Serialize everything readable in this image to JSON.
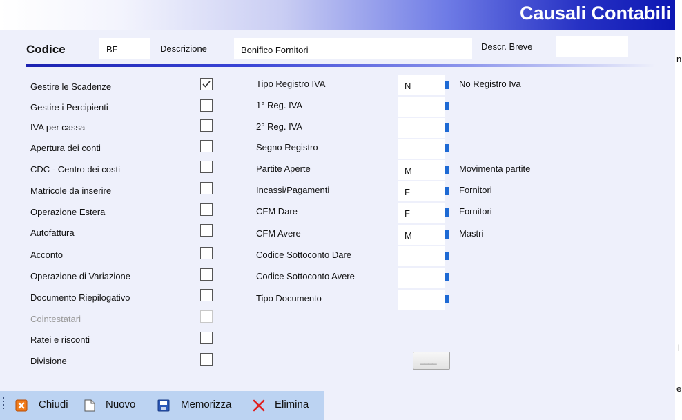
{
  "window": {
    "title": "Causali Contabili"
  },
  "header": {
    "codice_label": "Codice",
    "codice_value": "BF",
    "descrizione_label": "Descrizione",
    "descrizione_value": "Bonifico Fornitori",
    "descr_breve_label": "Descr. Breve",
    "descr_breve_value": ""
  },
  "options": [
    {
      "label": "Gestire le Scadenze",
      "checked": true,
      "enabled": true
    },
    {
      "label": "Gestire i Percipienti",
      "checked": false,
      "enabled": true
    },
    {
      "label": "IVA per cassa",
      "checked": false,
      "enabled": true
    },
    {
      "label": "Apertura dei conti",
      "checked": false,
      "enabled": true
    },
    {
      "label": "CDC - Centro dei costi",
      "checked": false,
      "enabled": true
    },
    {
      "label": "Matricole da inserire",
      "checked": false,
      "enabled": true
    },
    {
      "label": "Operazione Estera",
      "checked": false,
      "enabled": true
    },
    {
      "label": "Autofattura",
      "checked": false,
      "enabled": true
    },
    {
      "label": "Acconto",
      "checked": false,
      "enabled": true
    },
    {
      "label": "Operazione di Variazione",
      "checked": false,
      "enabled": true
    },
    {
      "label": "Documento Riepilogativo",
      "checked": false,
      "enabled": true
    },
    {
      "label": "Cointestatari",
      "checked": false,
      "enabled": false
    },
    {
      "label": "Ratei e risconti",
      "checked": false,
      "enabled": true
    },
    {
      "label": "Divisione",
      "checked": false,
      "enabled": true
    }
  ],
  "fields": [
    {
      "label": "Tipo Registro IVA",
      "value": "N",
      "description": "No Registro Iva"
    },
    {
      "label": "1° Reg. IVA",
      "value": "",
      "description": ""
    },
    {
      "label": "2° Reg. IVA",
      "value": "",
      "description": ""
    },
    {
      "label": "Segno Registro",
      "value": "",
      "description": ""
    },
    {
      "label": "Partite Aperte",
      "value": "M",
      "description": "Movimenta partite"
    },
    {
      "label": "Incassi/Pagamenti",
      "value": "F",
      "description": "Fornitori"
    },
    {
      "label": "CFM Dare",
      "value": "F",
      "description": "Fornitori"
    },
    {
      "label": "CFM Avere",
      "value": "M",
      "description": "Mastri"
    },
    {
      "label": "Codice Sottoconto Dare",
      "value": "",
      "description": ""
    },
    {
      "label": "Codice Sottoconto  Avere",
      "value": "",
      "description": ""
    },
    {
      "label": "Tipo Documento",
      "value": "",
      "description": ""
    }
  ],
  "ellipsis_button": {
    "label": "____"
  },
  "toolbar": {
    "close_label": "Chiudi",
    "new_label": "Nuovo",
    "save_label": "Memorizza",
    "delete_label": "Elimina"
  },
  "background_fragments": {
    "a": "n",
    "b": "l",
    "c": "e"
  },
  "icons": {
    "close": "close-icon",
    "new": "new-document-icon",
    "save": "save-disk-icon",
    "delete": "delete-x-icon",
    "checked": "checkmark-icon"
  },
  "colors": {
    "title_bar_end": "#0d17b3",
    "separator": "#1b22b0",
    "form_background": "#eef0fb",
    "toolbar_background": "#bcd3f2",
    "field_button": "#1e6ad4",
    "delete_red": "#e02020"
  }
}
